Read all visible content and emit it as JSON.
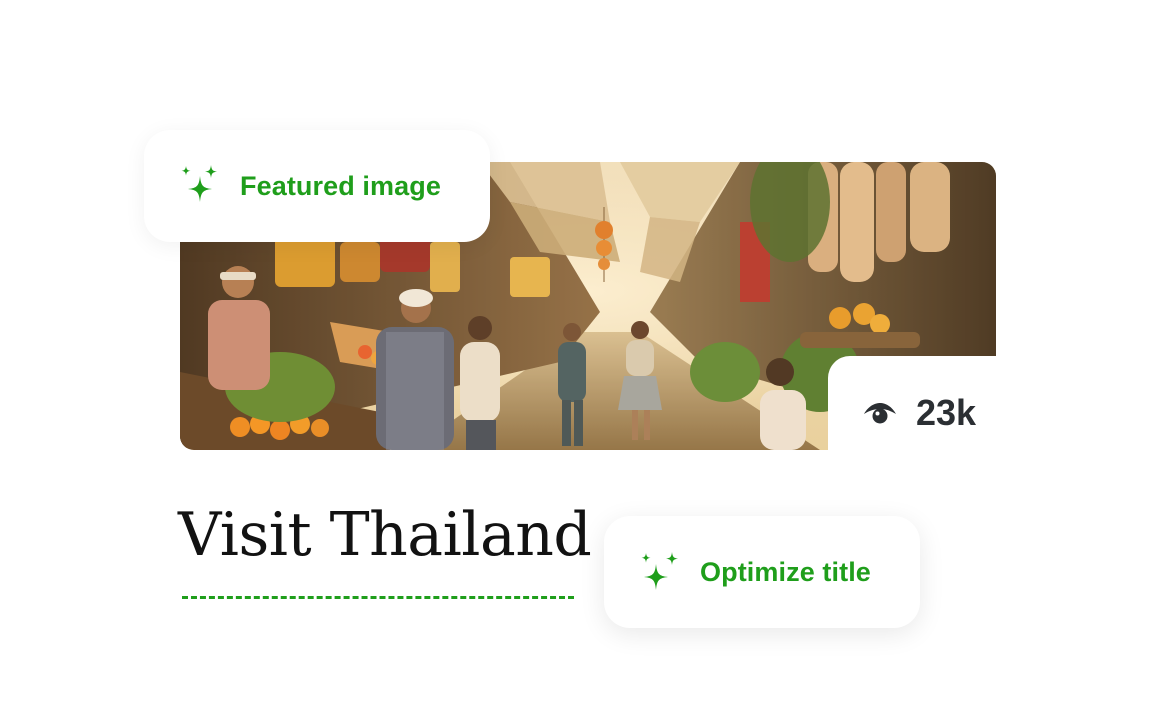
{
  "featured_chip": {
    "label": "Featured image",
    "icon": "sparkles-icon"
  },
  "hero_image": {
    "alt": "Thai street market"
  },
  "views": {
    "icon": "eye-icon",
    "count": "23k"
  },
  "post_title": {
    "text": "Visit Thailand"
  },
  "optimize_chip": {
    "label": "Optimize title",
    "icon": "sparkles-icon"
  },
  "colors": {
    "accent_green": "#1f9e1b",
    "text_dark": "#2b2f33",
    "title_text": "#121212"
  }
}
